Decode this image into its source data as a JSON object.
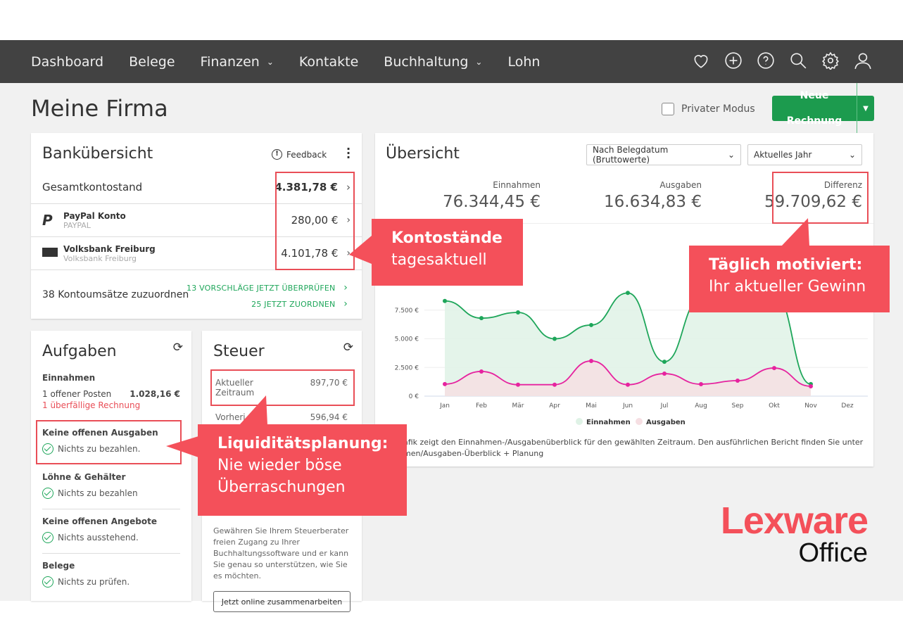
{
  "nav": {
    "items": [
      {
        "label": "Dashboard"
      },
      {
        "label": "Belege"
      },
      {
        "label": "Finanzen",
        "dropdown": true
      },
      {
        "label": "Kontakte"
      },
      {
        "label": "Buchhaltung",
        "dropdown": true
      },
      {
        "label": "Lohn"
      }
    ],
    "icons": [
      "heart-icon",
      "plus-circle-icon",
      "help-icon",
      "search-icon",
      "gear-icon",
      "user-icon"
    ]
  },
  "page": {
    "title": "Meine Firma",
    "private_mode": "Privater Modus",
    "new_invoice": "Neue Rechnung"
  },
  "bank": {
    "title": "Bankübersicht",
    "feedback": "Feedback",
    "total_label": "Gesamtkontostand",
    "total": "4.381,78 €",
    "accounts": [
      {
        "name": "PayPal Konto",
        "sub": "PAYPAL",
        "amount": "280,00 €"
      },
      {
        "name": "Volksbank Freiburg",
        "sub": "Volksbank Freiburg",
        "amount": "4.101,78 €"
      }
    ],
    "unassigned": "38 Kontoumsätze zuzuordnen",
    "link1": "13 VORSCHLÄGE JETZT ÜBERPRÜFEN",
    "link2": "25 JETZT ZUORDNEN"
  },
  "tasks": {
    "title": "Aufgaben",
    "income_h": "Einnahmen",
    "open": "1  offener Posten",
    "open_amt": "1.028,16 €",
    "overdue": "1  überfällige Rechnung",
    "sections": [
      {
        "h": "Keine offenen Ausgaben",
        "t": "Nichts zu bezahlen."
      },
      {
        "h": "Löhne & Gehälter",
        "t": "Nichts zu bezahlen"
      },
      {
        "h": "Keine offenen Angebote",
        "t": "Nichts ausstehend."
      },
      {
        "h": "Belege",
        "t": "Nichts zu prüfen."
      }
    ]
  },
  "tax": {
    "title": "Steuer",
    "cur_label": "Aktueller Zeitraum",
    "cur": "897,70 €",
    "prev_label": "Vorheri",
    "prev": "596,94 €",
    "text": "Gewähren Sie Ihrem Steuerberater freien Zugang zu Ihrer Buchhaltungssoftware und er kann Sie genau so unterstützen, wie Sie es möchten.",
    "button": "Jetzt online zusammenarbeiten"
  },
  "overview": {
    "title": "Übersicht",
    "filter1": "Nach Belegdatum (Bruttowerte)",
    "filter2": "Aktuelles Jahr",
    "kpis": [
      {
        "label": "Einnahmen",
        "value": "76.344,45 €"
      },
      {
        "label": "Ausgaben",
        "value": "16.634,83 €"
      },
      {
        "label": "Differenz",
        "value": "59.709,62 €"
      }
    ],
    "footer1": "afik zeigt den Einnahmen-/Ausgabenüberblick für den gewählten Zeitraum. Den ausführlichen Bericht finden Sie unter",
    "footer2": "men/Ausgaben-Überblick + Planung"
  },
  "chart_data": {
    "type": "area",
    "categories": [
      "Jan",
      "Feb",
      "Mär",
      "Apr",
      "Mai",
      "Jun",
      "Jul",
      "Aug",
      "Sep",
      "Okt",
      "Nov",
      "Dez"
    ],
    "yticks": [
      "0 €",
      "2.500 €",
      "5.000 €",
      "7.500 €"
    ],
    "ylim": [
      0,
      10000
    ],
    "legend_position": "bottom",
    "series": [
      {
        "name": "Einnahmen",
        "color": "#1ea65a",
        "fill": "#dff2e6",
        "values": [
          8300,
          6800,
          7300,
          5000,
          6200,
          9000,
          3000,
          8500,
          9500,
          9000,
          1050,
          null
        ]
      },
      {
        "name": "Ausgaben",
        "color": "#e6239f",
        "fill": "#f6dfe3",
        "values": [
          1050,
          2150,
          1000,
          1000,
          3070,
          1000,
          1960,
          1040,
          1350,
          2450,
          860,
          null
        ]
      }
    ]
  },
  "callouts": {
    "c1a": "Kontostände",
    "c1b": "tagesaktuell",
    "c2a": "Täglich motiviert:",
    "c2b": "Ihr aktueller Gewinn",
    "c3a": "Liquiditätsplanung:",
    "c3b": "Nie wieder böse",
    "c3c": "Überraschungen"
  },
  "logo": {
    "a": "Lexware",
    "b": "Office"
  }
}
